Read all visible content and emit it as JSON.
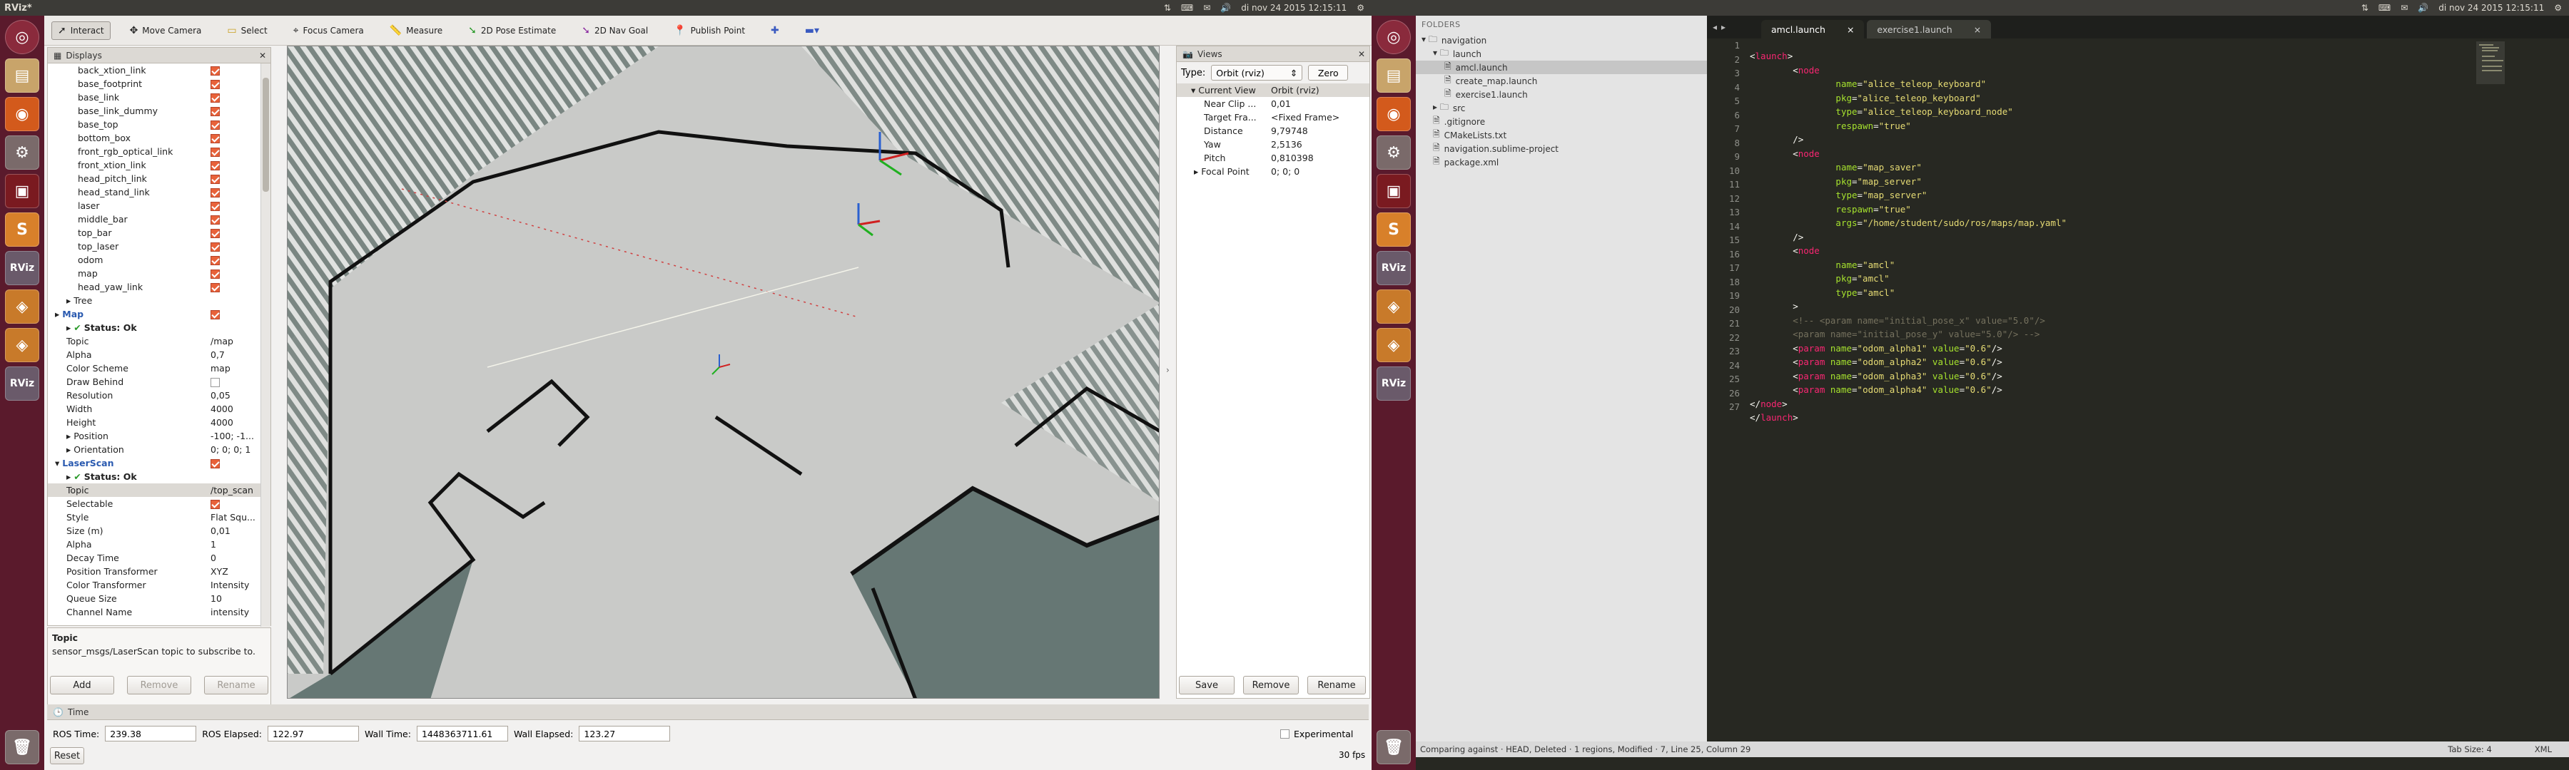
{
  "left_topbar": {
    "title": "RViz*",
    "time": "di nov 24 2015 12:15:11"
  },
  "right_topbar": {
    "time": "di nov 24 2015 12:15:11"
  },
  "toolbar": {
    "tools": [
      "Interact",
      "Move Camera",
      "Select",
      "Focus Camera",
      "Measure",
      "2D Pose Estimate",
      "2D Nav Goal",
      "Publish Point"
    ]
  },
  "displays": {
    "title": "Displays",
    "rows": [
      {
        "k": "back_xtion_link",
        "v": "",
        "chk": true,
        "ind": 2
      },
      {
        "k": "base_footprint",
        "v": "",
        "chk": true,
        "ind": 2
      },
      {
        "k": "base_link",
        "v": "",
        "chk": true,
        "ind": 2
      },
      {
        "k": "base_link_dummy",
        "v": "",
        "chk": true,
        "ind": 2
      },
      {
        "k": "base_top",
        "v": "",
        "chk": true,
        "ind": 2
      },
      {
        "k": "bottom_box",
        "v": "",
        "chk": true,
        "ind": 2
      },
      {
        "k": "front_rgb_optical_link",
        "v": "",
        "chk": true,
        "ind": 2
      },
      {
        "k": "front_xtion_link",
        "v": "",
        "chk": true,
        "ind": 2
      },
      {
        "k": "head_pitch_link",
        "v": "",
        "chk": true,
        "ind": 2
      },
      {
        "k": "head_stand_link",
        "v": "",
        "chk": true,
        "ind": 2
      },
      {
        "k": "laser",
        "v": "",
        "chk": true,
        "ind": 2
      },
      {
        "k": "middle_bar",
        "v": "",
        "chk": true,
        "ind": 2
      },
      {
        "k": "top_bar",
        "v": "",
        "chk": true,
        "ind": 2
      },
      {
        "k": "top_laser",
        "v": "",
        "chk": true,
        "ind": 2
      },
      {
        "k": "odom",
        "v": "",
        "chk": true,
        "ind": 2
      },
      {
        "k": "map",
        "v": "",
        "chk": true,
        "ind": 2
      },
      {
        "k": "head_yaw_link",
        "v": "",
        "chk": true,
        "ind": 2
      },
      {
        "k": "Tree",
        "v": "",
        "chk": false,
        "ind": 1,
        "arrow": true
      },
      {
        "k": "Map",
        "v": "",
        "chk": true,
        "ind": 0,
        "arrow": true,
        "blue": true
      },
      {
        "k": "Status: Ok",
        "v": "",
        "chk": false,
        "ind": 1,
        "arrow": true,
        "ok": true
      },
      {
        "k": "Topic",
        "v": "/map",
        "ind": 1
      },
      {
        "k": "Alpha",
        "v": "0,7",
        "ind": 1
      },
      {
        "k": "Color Scheme",
        "v": "map",
        "ind": 1
      },
      {
        "k": "Draw Behind",
        "v": "",
        "ind": 1,
        "emptychk": true
      },
      {
        "k": "Resolution",
        "v": "0,05",
        "ind": 1
      },
      {
        "k": "Width",
        "v": "4000",
        "ind": 1
      },
      {
        "k": "Height",
        "v": "4000",
        "ind": 1
      },
      {
        "k": "Position",
        "v": "-100; -1...",
        "ind": 1,
        "arrow": true
      },
      {
        "k": "Orientation",
        "v": "0; 0; 0; 1",
        "ind": 1,
        "arrow": true
      },
      {
        "k": "LaserScan",
        "v": "",
        "chk": true,
        "ind": 0,
        "arrow": true,
        "blue": true,
        "open": true
      },
      {
        "k": "Status: Ok",
        "v": "",
        "ind": 1,
        "arrow": true,
        "ok": true
      },
      {
        "k": "Topic",
        "v": "/top_scan",
        "ind": 1,
        "sel": true
      },
      {
        "k": "Selectable",
        "v": "",
        "chk": true,
        "ind": 1
      },
      {
        "k": "Style",
        "v": "Flat Squ...",
        "ind": 1
      },
      {
        "k": "Size (m)",
        "v": "0,01",
        "ind": 1
      },
      {
        "k": "Alpha",
        "v": "1",
        "ind": 1
      },
      {
        "k": "Decay Time",
        "v": "0",
        "ind": 1
      },
      {
        "k": "Position Transformer",
        "v": "XYZ",
        "ind": 1
      },
      {
        "k": "Color Transformer",
        "v": "Intensity",
        "ind": 1
      },
      {
        "k": "Queue Size",
        "v": "10",
        "ind": 1
      },
      {
        "k": "Channel Name",
        "v": "intensity",
        "ind": 1
      }
    ],
    "desc_title": "Topic",
    "desc_text": "sensor_msgs/LaserScan topic to subscribe to.",
    "add": "Add",
    "remove": "Remove",
    "rename": "Rename"
  },
  "views": {
    "title": "Views",
    "type_label": "Type:",
    "type_value": "Orbit (rviz)",
    "zero": "Zero",
    "rows": [
      {
        "k": "Current View",
        "v": "Orbit (rviz)",
        "head": true
      },
      {
        "k": "Near Clip ...",
        "v": "0,01"
      },
      {
        "k": "Target Fra...",
        "v": "<Fixed Frame>"
      },
      {
        "k": "Distance",
        "v": "9,79748"
      },
      {
        "k": "Yaw",
        "v": "2,5136"
      },
      {
        "k": "Pitch",
        "v": "0,810398"
      },
      {
        "k": "Focal Point",
        "v": "0; 0; 0",
        "arrow": true
      }
    ],
    "save": "Save",
    "remove": "Remove",
    "rename": "Rename"
  },
  "time": {
    "title": "Time",
    "ros_time_label": "ROS Time:",
    "ros_time": "239.38",
    "ros_elapsed_label": "ROS Elapsed:",
    "ros_elapsed": "122.97",
    "wall_time_label": "Wall Time:",
    "wall_time": "1448363711.61",
    "wall_elapsed_label": "Wall Elapsed:",
    "wall_elapsed": "123.27",
    "experimental": "Experimental",
    "reset": "Reset",
    "fps": "30 fps"
  },
  "sublime": {
    "folders_label": "FOLDERS",
    "tree": [
      {
        "t": "navigation",
        "ind": 0,
        "folder": true,
        "open": true
      },
      {
        "t": "launch",
        "ind": 1,
        "folder": true,
        "open": true
      },
      {
        "t": "amcl.launch",
        "ind": 2,
        "sel": true
      },
      {
        "t": "create_map.launch",
        "ind": 2
      },
      {
        "t": "exercise1.launch",
        "ind": 2
      },
      {
        "t": "src",
        "ind": 1,
        "folder": true
      },
      {
        "t": ".gitignore",
        "ind": 1
      },
      {
        "t": "CMakeLists.txt",
        "ind": 1
      },
      {
        "t": "navigation.sublime-project",
        "ind": 1
      },
      {
        "t": "package.xml",
        "ind": 1
      }
    ],
    "tabs": [
      "amcl.launch",
      "exercise1.launch"
    ],
    "line_numbers": [
      "1",
      "2",
      "3",
      "4",
      "5",
      "6",
      "7",
      "8",
      "9",
      "10",
      "11",
      "12",
      "13",
      "14",
      "15",
      "16",
      "17",
      "18",
      "19",
      "20",
      "21",
      "22",
      "23",
      "24",
      "25",
      "26",
      "27"
    ],
    "status_left": "Comparing against · HEAD, Deleted · 1 regions, Modified · 7, Line 25, Column 29",
    "status_tab": "Tab Size: 4",
    "status_syntax": "XML"
  },
  "colors": {
    "launcher": "#5a1a2c",
    "accent": "#e8623a",
    "editor_bg": "#272822"
  }
}
